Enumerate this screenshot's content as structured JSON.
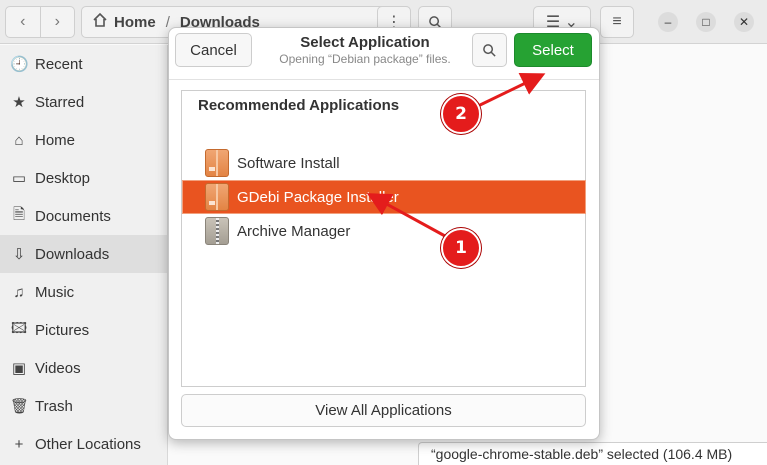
{
  "file_manager": {
    "path": {
      "home": "Home",
      "current": "Downloads"
    },
    "sidebar": {
      "items": [
        {
          "label": "Recent",
          "icon": "clock-icon",
          "glyph": "🕘"
        },
        {
          "label": "Starred",
          "icon": "star-icon",
          "glyph": "★"
        },
        {
          "label": "Home",
          "icon": "home-icon",
          "glyph": "⌂"
        },
        {
          "label": "Desktop",
          "icon": "desktop-icon",
          "glyph": "▭"
        },
        {
          "label": "Documents",
          "icon": "document-icon",
          "glyph": "🗎"
        },
        {
          "label": "Downloads",
          "icon": "download-icon",
          "glyph": "⇩",
          "active": true
        },
        {
          "label": "Music",
          "icon": "music-icon",
          "glyph": "♫"
        },
        {
          "label": "Pictures",
          "icon": "picture-icon",
          "glyph": "🖾"
        },
        {
          "label": "Videos",
          "icon": "video-icon",
          "glyph": "▣"
        },
        {
          "label": "Trash",
          "icon": "trash-icon",
          "glyph": "🗑"
        },
        {
          "label": "Other Locations",
          "icon": "plus-icon",
          "glyph": "+"
        }
      ]
    },
    "status": "“google-chrome-stable.deb” selected  (106.4 MB)"
  },
  "dialog": {
    "title": "Select Application",
    "subtitle": "Opening “Debian package” files.",
    "cancel_label": "Cancel",
    "select_label": "Select",
    "list_heading": "Recommended Applications",
    "apps": [
      {
        "name": "Software Install",
        "icon": "software-install-icon"
      },
      {
        "name": "GDebi Package Installer",
        "icon": "gdebi-icon",
        "selected": true
      },
      {
        "name": "Archive Manager",
        "icon": "archive-manager-icon"
      }
    ],
    "view_all_label": "View All Applications"
  },
  "annotations": {
    "badge_1": "1",
    "badge_2": "2",
    "color": "#e41c1c"
  },
  "colors": {
    "accent_selected": "#e95420",
    "select_button": "#26a233"
  }
}
